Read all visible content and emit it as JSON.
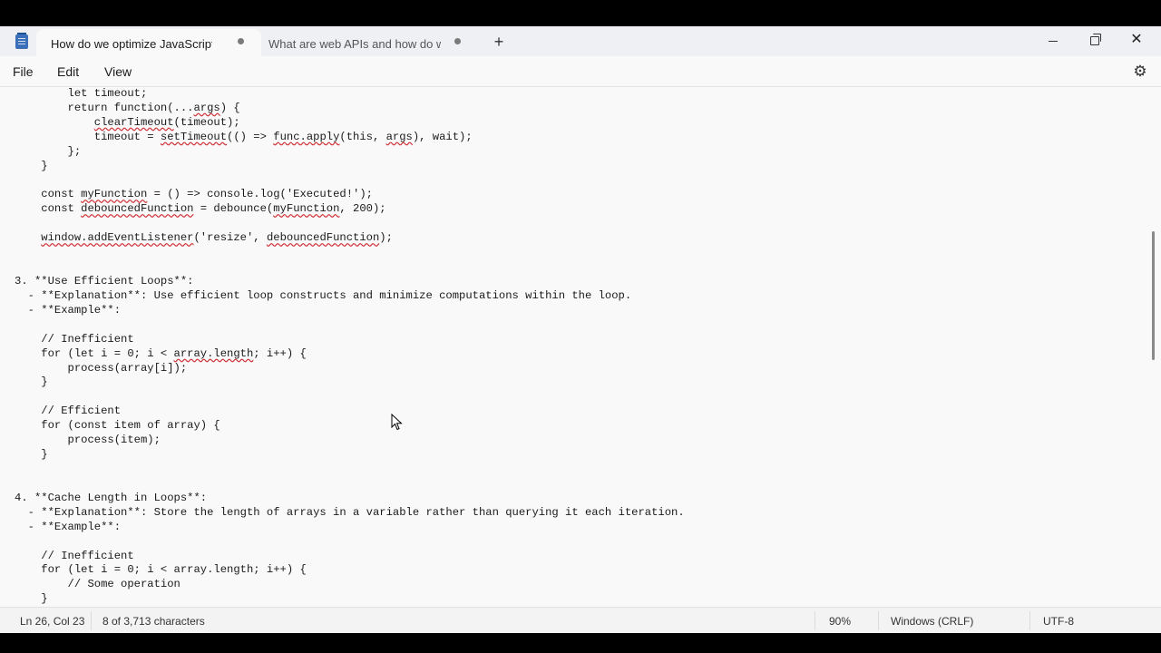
{
  "tabs": [
    {
      "label": "How do we optimize JavaScript per",
      "active": true
    },
    {
      "label": "What are web APIs and how do we u",
      "active": false
    }
  ],
  "window_controls": {
    "new_tab": "+",
    "minimize": "minimize",
    "restore": "restore",
    "close": "✕"
  },
  "menu": {
    "file": "File",
    "edit": "Edit",
    "view": "View"
  },
  "settings_icon": "⚙",
  "code_lines": [
    "        let timeout;",
    "        return function(...args) {",
    "            clearTimeout(timeout);",
    "            timeout = setTimeout(() => func.apply(this, args), wait);",
    "        };",
    "    }",
    "",
    "    const myFunction = () => console.log('Executed!');",
    "    const debouncedFunction = debounce(myFunction, 200);",
    "",
    "    window.addEventListener('resize', debouncedFunction);",
    "",
    "",
    "3. **Use Efficient Loops**:",
    "  - **Explanation**: Use efficient loop constructs and minimize computations within the loop.",
    "  - **Example**:",
    "",
    "    // Inefficient",
    "    for (let i = 0; i < array.length; i++) {",
    "        process(array[i]);",
    "    }",
    "",
    "    // Efficient",
    "    for (const item of array) {",
    "        process(item);",
    "    }",
    "",
    "",
    "4. **Cache Length in Loops**:",
    "  - **Explanation**: Store the length of arrays in a variable rather than querying it each iteration.",
    "  - **Example**:",
    "",
    "    // Inefficient",
    "    for (let i = 0; i < array.length; i++) {",
    "        // Some operation",
    "    }"
  ],
  "status": {
    "position": "Ln 26, Col 23",
    "chars": "8 of 3,713 characters",
    "zoom": "90%",
    "line_ending": "Windows (CRLF)",
    "encoding": "UTF-8"
  },
  "colors": {
    "spellcheck_underline": "#d13438",
    "window_bg": "#f9f9f9",
    "titlebar_bg": "#eef0f3"
  }
}
